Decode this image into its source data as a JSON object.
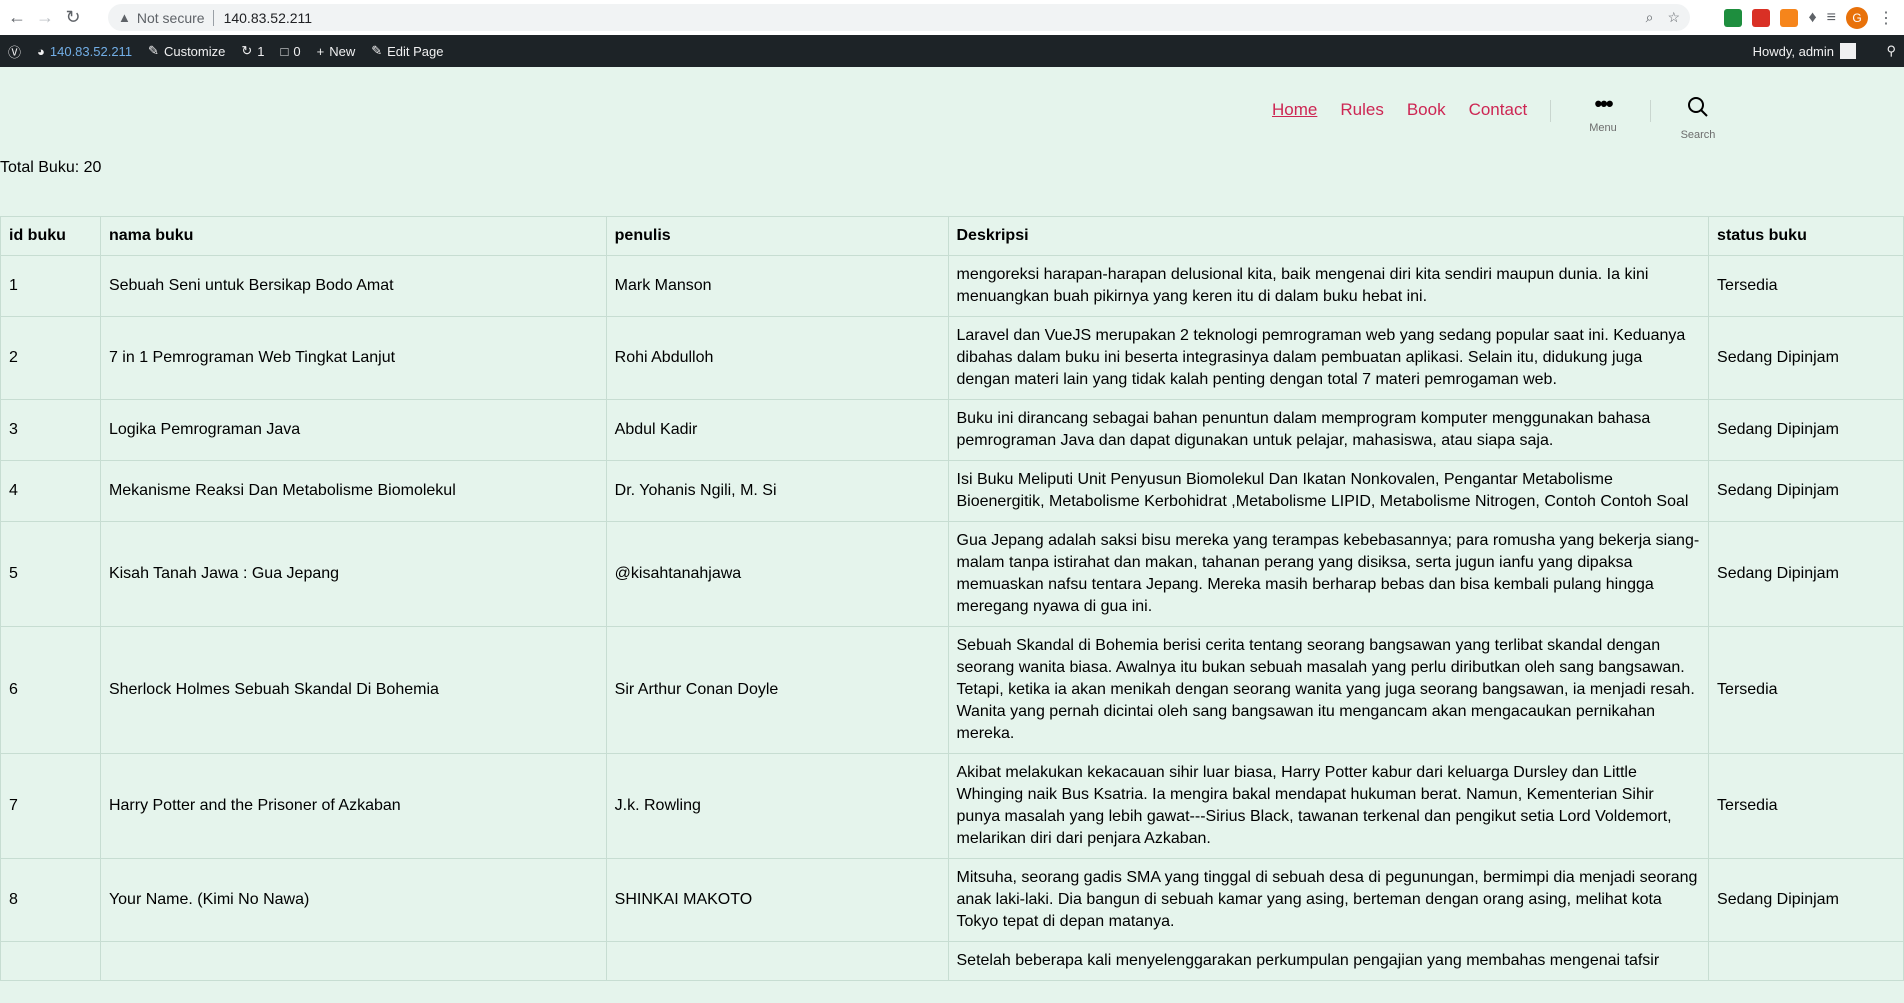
{
  "browser": {
    "security_label": "Not secure",
    "url": "140.83.52.211",
    "profile_initial": "G"
  },
  "adminbar": {
    "site": "140.83.52.211",
    "customize": "Customize",
    "updates": "1",
    "comments": "0",
    "new": "New",
    "edit_page": "Edit Page",
    "howdy": "Howdy, admin"
  },
  "header": {
    "nav": [
      "Home",
      "Rules",
      "Book",
      "Contact"
    ],
    "menu_label": "Menu",
    "search_label": "Search"
  },
  "total_label": "Total Buku: 20",
  "table": {
    "columns": [
      "id buku",
      "nama buku",
      "penulis",
      "Deskripsi",
      "status buku"
    ],
    "rows": [
      {
        "id": "1",
        "nama": "Sebuah Seni untuk Bersikap Bodo Amat",
        "penulis": "Mark Manson",
        "deskripsi": "mengoreksi harapan-harapan delusional kita, baik mengenai diri kita sendiri maupun dunia. Ia kini menuangkan buah pikirnya yang keren itu di dalam buku hebat ini.",
        "status": "Tersedia"
      },
      {
        "id": "2",
        "nama": "7 in 1 Pemrograman Web Tingkat Lanjut",
        "penulis": "Rohi Abdulloh",
        "deskripsi": "Laravel dan VueJS merupakan 2 teknologi pemrograman web yang sedang popular saat ini. Keduanya dibahas dalam buku ini beserta integrasinya dalam pembuatan aplikasi. Selain itu, didukung juga dengan materi lain yang tidak kalah penting dengan total 7 materi pemrogaman web.",
        "status": "Sedang Dipinjam"
      },
      {
        "id": "3",
        "nama": "Logika Pemrograman Java",
        "penulis": "Abdul Kadir",
        "deskripsi": "Buku ini dirancang sebagai bahan penuntun dalam memprogram komputer menggunakan bahasa pemrograman Java dan dapat digunakan untuk pelajar, mahasiswa, atau siapa saja.",
        "status": "Sedang Dipinjam"
      },
      {
        "id": "4",
        "nama": "Mekanisme Reaksi Dan Metabolisme Biomolekul",
        "penulis": "Dr. Yohanis Ngili, M. Si",
        "deskripsi": "Isi Buku Meliputi Unit Penyusun Biomolekul Dan Ikatan Nonkovalen, Pengantar Metabolisme Bioenergitik, Metabolisme Kerbohidrat ,Metabolisme LIPID, Metabolisme Nitrogen, Contoh Contoh Soal",
        "status": "Sedang Dipinjam"
      },
      {
        "id": "5",
        "nama": "Kisah Tanah Jawa : Gua Jepang",
        "penulis": "@kisahtanahjawa",
        "deskripsi": "Gua Jepang adalah saksi bisu mereka yang terampas kebebasannya; para romusha yang bekerja siang-malam tanpa istirahat dan makan, tahanan perang yang disiksa, serta jugun ianfu yang dipaksa memuaskan nafsu tentara Jepang. Mereka masih berharap bebas dan bisa kembali pulang hingga meregang nyawa di gua ini.",
        "status": "Sedang Dipinjam"
      },
      {
        "id": "6",
        "nama": "Sherlock Holmes Sebuah Skandal Di Bohemia",
        "penulis": "Sir Arthur Conan Doyle",
        "deskripsi": "Sebuah Skandal di Bohemia berisi cerita tentang seorang bangsawan yang terlibat skandal dengan seorang wanita biasa. Awalnya itu bukan sebuah masalah yang perlu diributkan oleh sang bangsawan. Tetapi, ketika ia akan menikah dengan seorang wanita yang juga seorang bangsawan, ia menjadi resah. Wanita yang pernah dicintai oleh sang bangsawan itu mengancam akan mengacaukan pernikahan mereka.",
        "status": "Tersedia"
      },
      {
        "id": "7",
        "nama": "Harry Potter and the Prisoner of Azkaban",
        "penulis": "J.k. Rowling",
        "deskripsi": "Akibat melakukan kekacauan sihir luar biasa, Harry Potter kabur dari keluarga Dursley dan Little Whinging naik Bus Ksatria. Ia mengira bakal mendapat hukuman berat. Namun, Kementerian Sihir punya masalah yang lebih gawat---Sirius Black, tawanan terkenal dan pengikut setia Lord Voldemort, melarikan diri dari penjara Azkaban.",
        "status": "Tersedia"
      },
      {
        "id": "8",
        "nama": "Your Name. (Kimi No Nawa)",
        "penulis": "SHINKAI MAKOTO",
        "deskripsi": "Mitsuha, seorang gadis SMA yang tinggal di sebuah desa di pegunungan, bermimpi dia menjadi seorang anak laki-laki. Dia bangun di sebuah kamar yang asing, berteman dengan orang asing, melihat kota Tokyo tepat di depan matanya.",
        "status": "Sedang Dipinjam"
      },
      {
        "id": "",
        "nama": "",
        "penulis": "",
        "deskripsi": "Setelah beberapa kali menyelenggarakan perkumpulan pengajian yang membahas mengenai tafsir",
        "status": ""
      }
    ]
  }
}
